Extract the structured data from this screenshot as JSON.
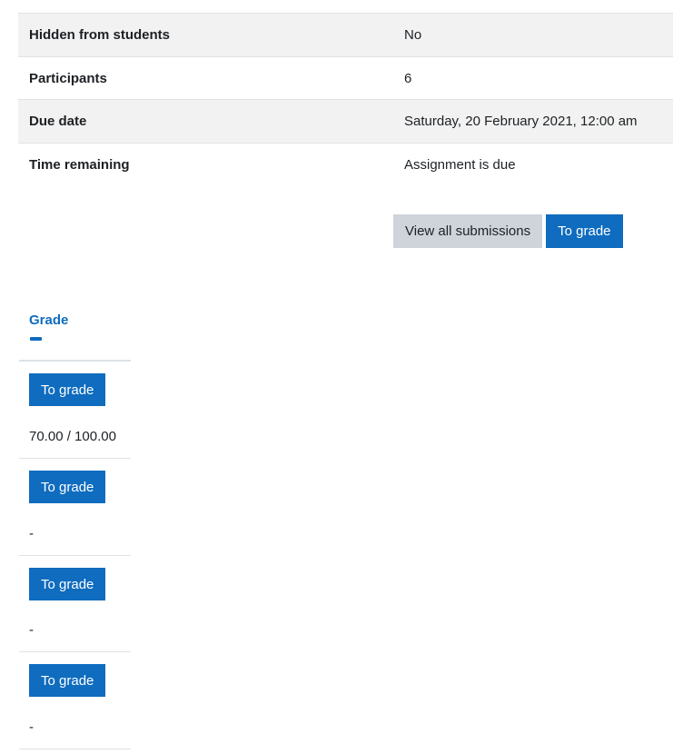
{
  "summary": {
    "rows": [
      {
        "label": "Hidden from students",
        "value": "No"
      },
      {
        "label": "Participants",
        "value": "6"
      },
      {
        "label": "Due date",
        "value": "Saturday, 20 February 2021, 12:00 am"
      },
      {
        "label": "Time remaining",
        "value": "Assignment is due"
      }
    ]
  },
  "actions": {
    "view_all_label": "View all submissions",
    "to_grade_label": "To grade"
  },
  "grade_column": {
    "header": "Grade",
    "collapse_icon": "minus-icon",
    "rows": [
      {
        "button_label": "To grade",
        "value": "70.00 / 100.00"
      },
      {
        "button_label": "To grade",
        "value": "-"
      },
      {
        "button_label": "To grade",
        "value": "-"
      },
      {
        "button_label": "To grade",
        "value": "-"
      }
    ]
  },
  "colors": {
    "primary": "#0f6cbf",
    "secondary": "#ced4da",
    "row_shade": "#f2f2f2",
    "border": "#dee2e6"
  }
}
